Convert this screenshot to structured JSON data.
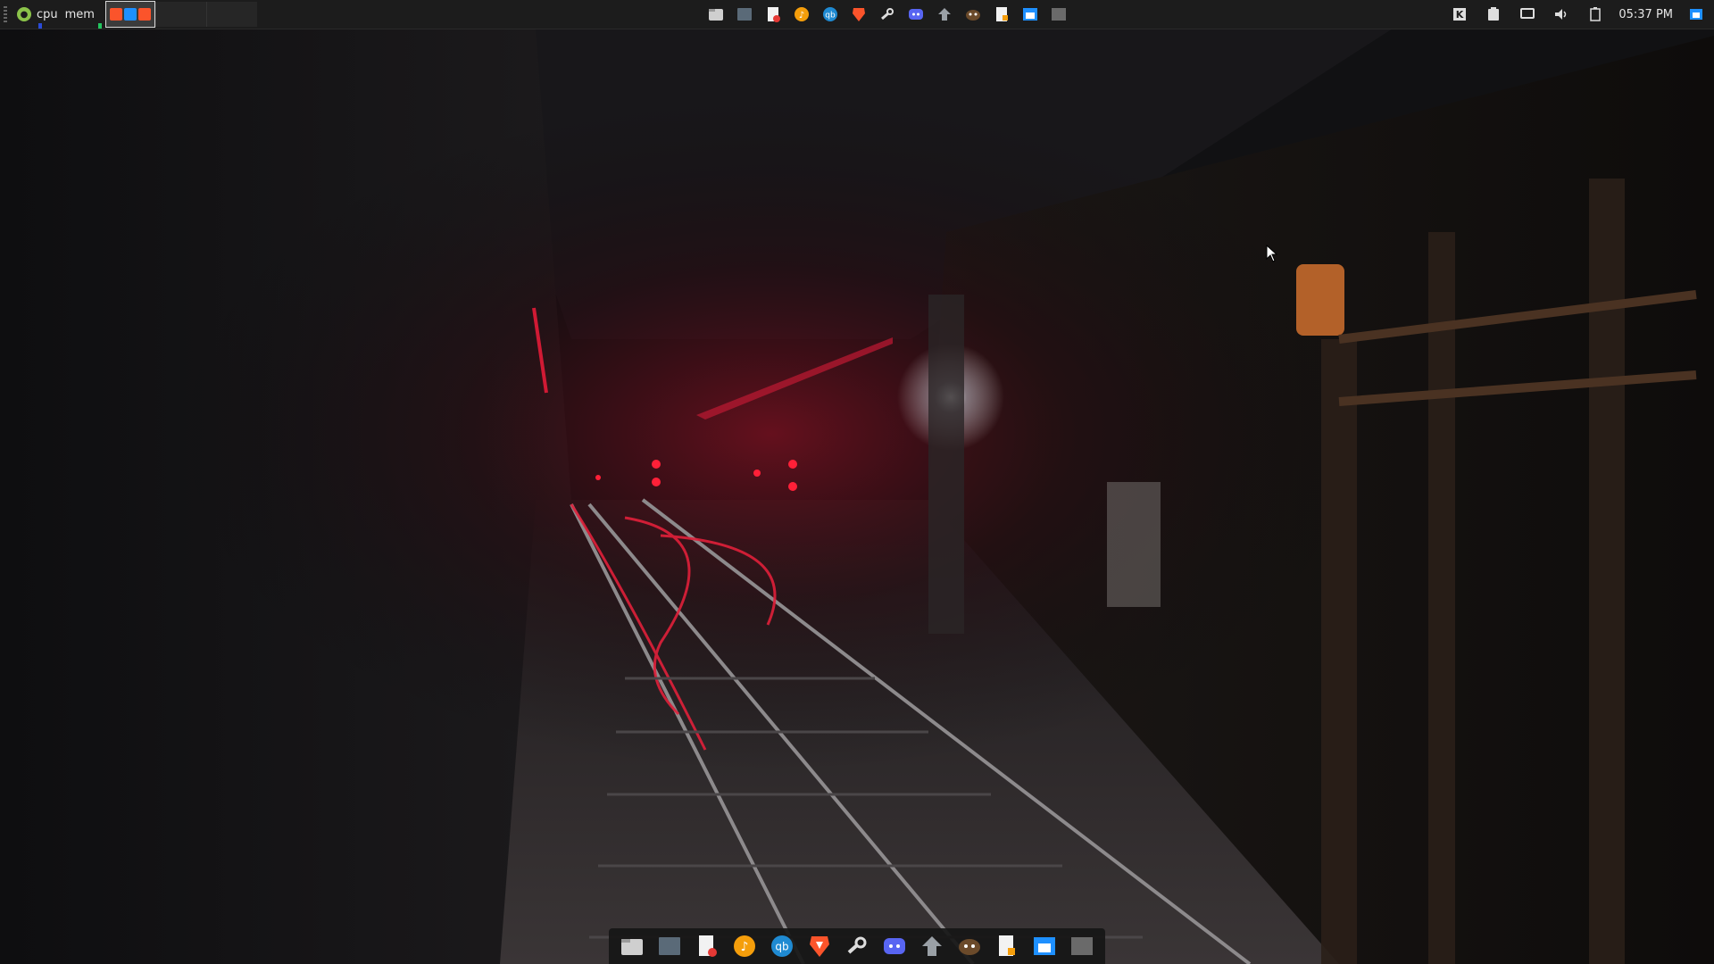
{
  "top_panel": {
    "monitors": [
      {
        "label": "cpu",
        "bar_color": "#2a4bd7"
      },
      {
        "label": "mem",
        "bar_color": "#22c55e"
      }
    ],
    "clock": "05:37 PM"
  },
  "panel_launchers": [
    "file-manager-icon",
    "terminal-icon",
    "text-editor-icon",
    "music-player-icon",
    "qbittorrent-icon",
    "brave-browser-icon",
    "steam-icon",
    "discord-icon",
    "package-manager-icon",
    "gimp-icon",
    "notes-app-icon",
    "window-manager-icon",
    "screenshot-icon"
  ],
  "tray_icons": [
    "keyboard-layout-icon",
    "clipboard-icon",
    "display-icon",
    "volume-icon",
    "battery-icon",
    "notification-icon"
  ],
  "dock_items": [
    "file-manager-icon",
    "terminal-icon",
    "text-editor-icon",
    "music-player-icon",
    "qbittorrent-icon",
    "brave-browser-icon",
    "steam-icon",
    "discord-icon",
    "package-manager-icon",
    "gimp-icon",
    "notes-app-icon",
    "window-manager-icon",
    "screenshot-icon"
  ],
  "colors": {
    "panel_bg": "#1c1c1c",
    "brave": "#fb542b",
    "qbittorrent": "#1f8ad2",
    "discord": "#5865f2",
    "music": "#f59e0b",
    "gimp": "#6b4a2a"
  }
}
